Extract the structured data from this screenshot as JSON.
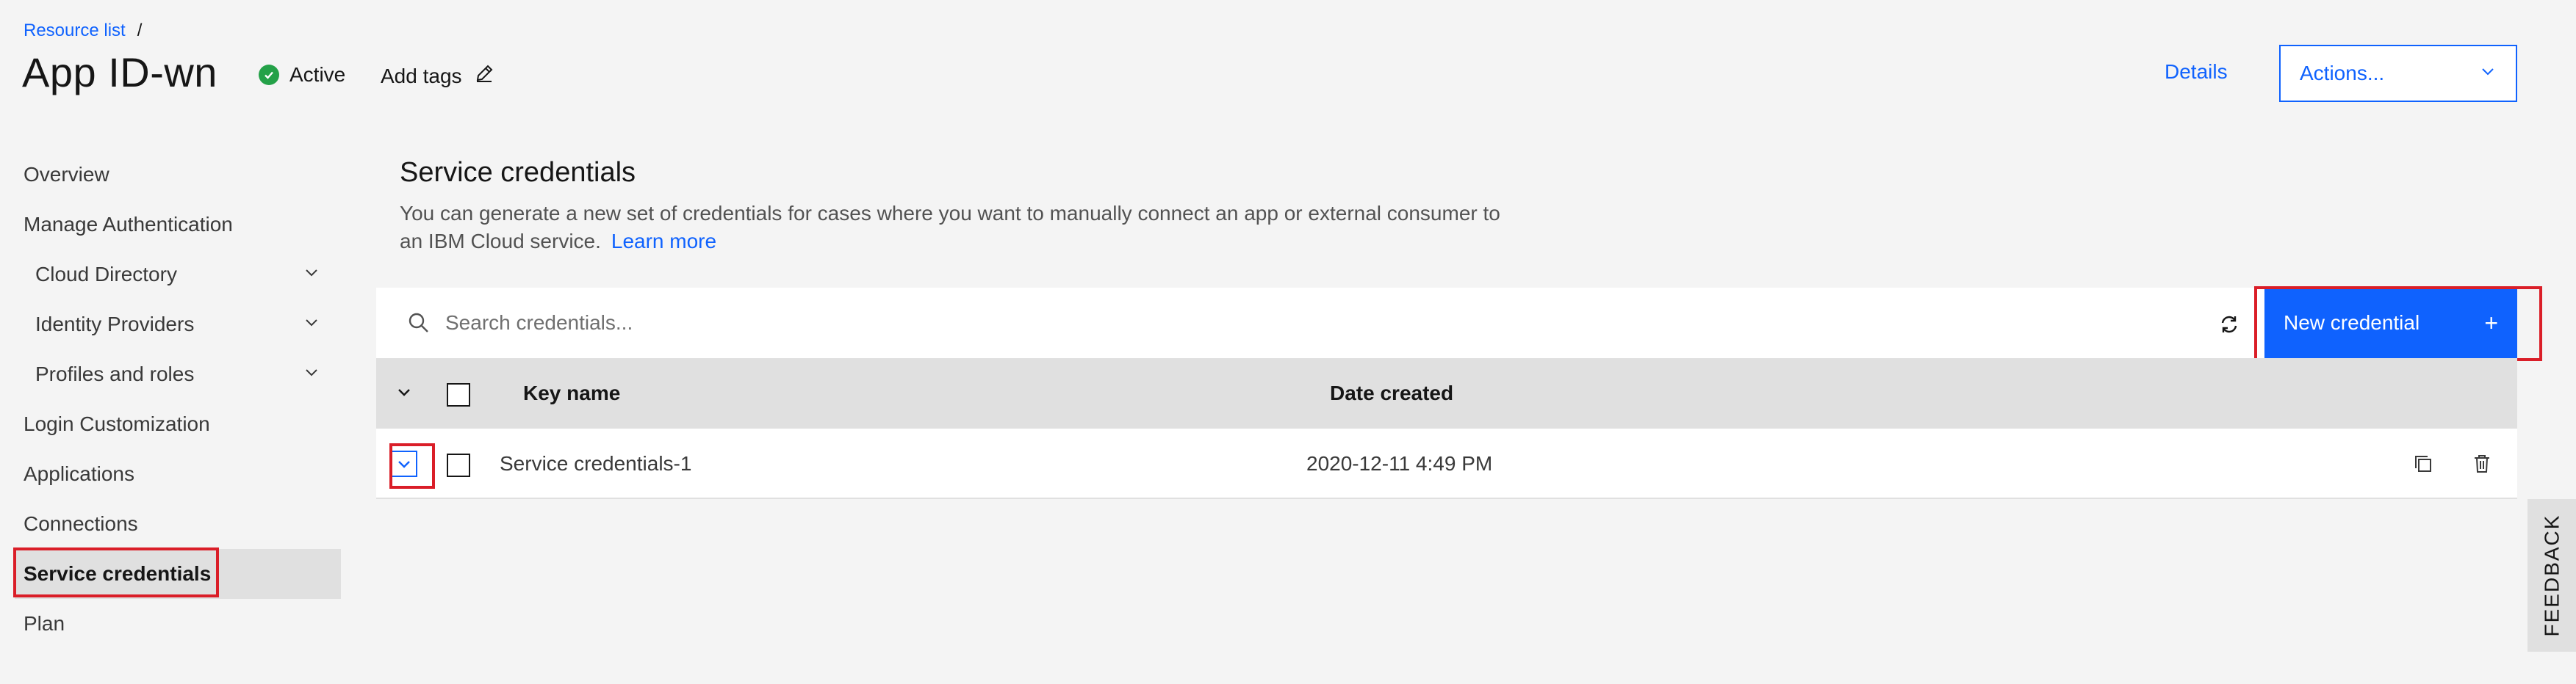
{
  "header": {
    "breadcrumb_link": "Resource list",
    "breadcrumb_sep": "/",
    "title": "App ID-wn",
    "status": "Active",
    "add_tags": "Add tags",
    "details": "Details",
    "actions": "Actions..."
  },
  "sidebar": {
    "items": [
      {
        "label": "Overview"
      },
      {
        "label": "Manage Authentication"
      },
      {
        "label": "Cloud Directory"
      },
      {
        "label": "Identity Providers"
      },
      {
        "label": "Profiles and roles"
      },
      {
        "label": "Login Customization"
      },
      {
        "label": "Applications"
      },
      {
        "label": "Connections"
      },
      {
        "label": "Service credentials"
      },
      {
        "label": "Plan"
      }
    ]
  },
  "main": {
    "title": "Service credentials",
    "description": "You can generate a new set of credentials for cases where you want to manually connect an app or external consumer to an IBM Cloud service.",
    "learn_more": "Learn more",
    "search_placeholder": "Search credentials...",
    "new_credential": "New credential",
    "new_credential_icon": "+",
    "table": {
      "columns": [
        "Key name",
        "Date created"
      ],
      "rows": [
        {
          "key_name": "Service credentials-1",
          "date_created": "2020-12-11 4:49 PM"
        }
      ]
    }
  },
  "feedback": "FEEDBACK",
  "colors": {
    "accent": "#0f62fe",
    "success": "#24a148",
    "highlight": "#da1e28",
    "background": "#f4f4f4"
  }
}
